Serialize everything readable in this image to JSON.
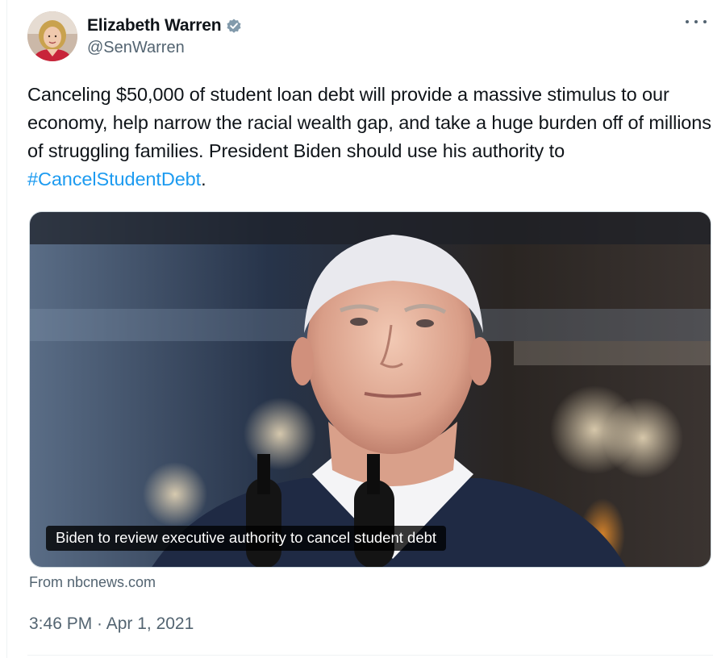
{
  "author": {
    "display_name": "Elizabeth Warren",
    "handle": "@SenWarren",
    "verified_icon": "verified-badge-icon"
  },
  "tweet": {
    "text_before_hashtag": "Canceling $50,000 of student loan debt will provide a massive stimulus to our economy, help narrow the racial wealth gap, and take a huge burden off of millions of struggling families. President Biden should use his authority to ",
    "hashtag": "#CancelStudentDebt",
    "text_after_hashtag": ".",
    "timestamp": "3:46 PM · Apr 1, 2021"
  },
  "link_card": {
    "title": "Biden to review executive authority to cancel student debt",
    "source": "From nbcnews.com"
  },
  "icons": {
    "more": "more-horizontal-icon",
    "verified": "verified-badge-icon"
  },
  "colors": {
    "link_blue": "#1d9bf0",
    "secondary_text": "#536471",
    "border": "#cfd9de"
  }
}
